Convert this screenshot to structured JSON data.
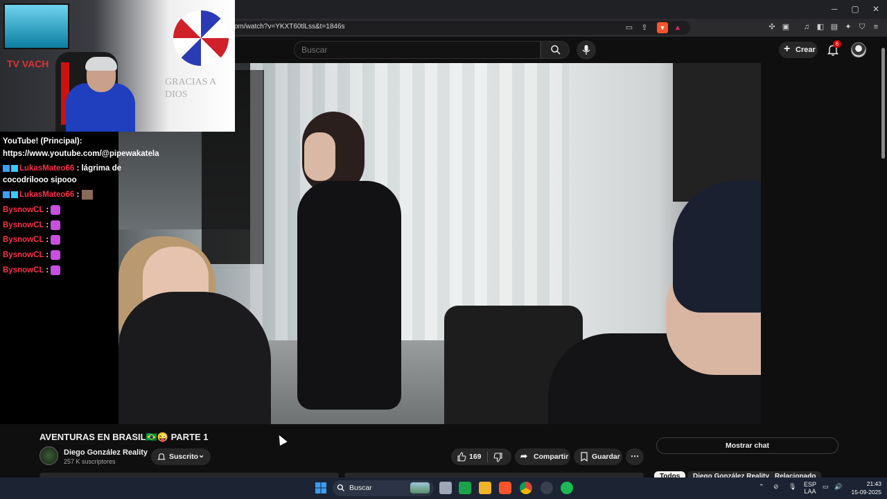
{
  "browser": {
    "url": "om/watch?v=YKXT60tlLss&t=1846s",
    "window_controls": {
      "minimize": "─",
      "maximize": "▢",
      "close": "✕"
    }
  },
  "header": {
    "search_placeholder": "Buscar",
    "create_label": "Crear",
    "notifications_count": "6"
  },
  "webcam": {
    "sign_text": "GRACIAS A DIOS",
    "flag_text": "TV VACH"
  },
  "chat": {
    "lines": [
      {
        "text": "YouTube! (Principal):"
      },
      {
        "text": "https://www.youtube.com/@pipewakatela"
      },
      {
        "name": "LukasMateo66",
        "text": " : lágrima de"
      },
      {
        "text": "cocodrilooo sipooo"
      },
      {
        "name": "LukasMateo66",
        "text": " :"
      },
      {
        "name": "BysnowCL",
        "text": " :"
      },
      {
        "name": "BysnowCL",
        "text": " :"
      },
      {
        "name": "BysnowCL",
        "text": " :"
      },
      {
        "name": "BysnowCL",
        "text": " :"
      },
      {
        "name": "BysnowCL",
        "text": " :"
      }
    ]
  },
  "video": {
    "title": "AVENTURAS EN BRASIL🇧🇷😜 PARTE 1",
    "channel_name": "Diego González Reality",
    "subscribers": "257 K suscriptores",
    "subscribe_label": "Suscrito",
    "likes": "169",
    "share_label": "Compartir",
    "save_label": "Guardar",
    "show_chat_label": "Mostrar chat"
  },
  "chips": [
    "Todos",
    "Diego González Reality",
    "Relacionado"
  ],
  "taskbar": {
    "search_label": "Buscar",
    "lang_top": "ESP",
    "lang_bottom": "LAA",
    "time": "21:43",
    "date": "15-09-2025"
  }
}
